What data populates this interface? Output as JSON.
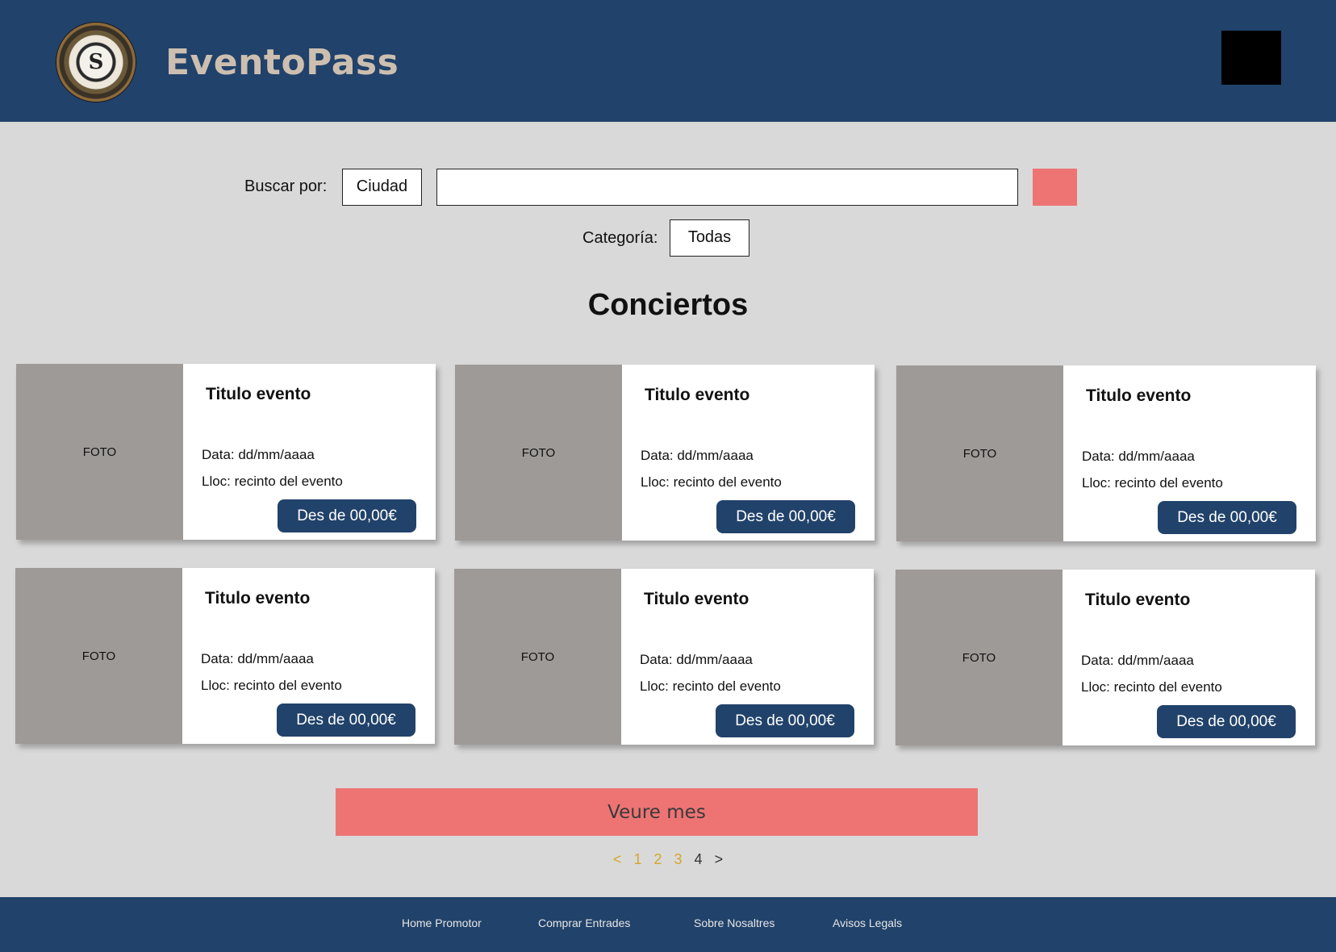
{
  "header": {
    "brand": "EventoPass",
    "logo_mark": "S",
    "user_icon": "user-avatar-block"
  },
  "search": {
    "label": "Buscar por:",
    "field_select": "Ciudad",
    "query_value": "",
    "category_label": "Categoría:",
    "category_select": "Todas",
    "button_icon": "search-icon"
  },
  "section": {
    "title": "Conciertos"
  },
  "events": [
    {
      "photo": "FOTO",
      "title": "Titulo evento",
      "date": "Data: dd/mm/aaaa",
      "place": "Lloc: recinto del evento",
      "price": "Des de 00,00€"
    },
    {
      "photo": "FOTO",
      "title": "Titulo evento",
      "date": "Data: dd/mm/aaaa",
      "place": "Lloc: recinto del evento",
      "price": "Des de 00,00€"
    },
    {
      "photo": "FOTO",
      "title": "Titulo evento",
      "date": "Data: dd/mm/aaaa",
      "place": "Lloc: recinto del evento",
      "price": "Des de 00,00€"
    },
    {
      "photo": "FOTO",
      "title": "Titulo evento",
      "date": "Data: dd/mm/aaaa",
      "place": "Lloc: recinto del evento",
      "price": "Des de 00,00€"
    },
    {
      "photo": "FOTO",
      "title": "Titulo evento",
      "date": "Data: dd/mm/aaaa",
      "place": "Lloc: recinto del evento",
      "price": "Des de 00,00€"
    },
    {
      "photo": "FOTO",
      "title": "Titulo evento",
      "date": "Data: dd/mm/aaaa",
      "place": "Lloc: recinto del evento",
      "price": "Des de 00,00€"
    }
  ],
  "more": {
    "label": "Veure mes"
  },
  "pagination": {
    "prev": "<",
    "pages": [
      "1",
      "2",
      "3",
      "4"
    ],
    "current": "4",
    "next": ">"
  },
  "footer": {
    "links": [
      "Home Promotor",
      "Comprar Entrades",
      "Sobre Nosaltres",
      "Avisos Legals"
    ]
  },
  "colors": {
    "primary": "#21426a",
    "accent": "#ee7474",
    "background": "#d9d9d9",
    "photo_placeholder": "#9e9a98",
    "brand_text": "#cdbfb0",
    "page_link": "#d4a72c"
  }
}
